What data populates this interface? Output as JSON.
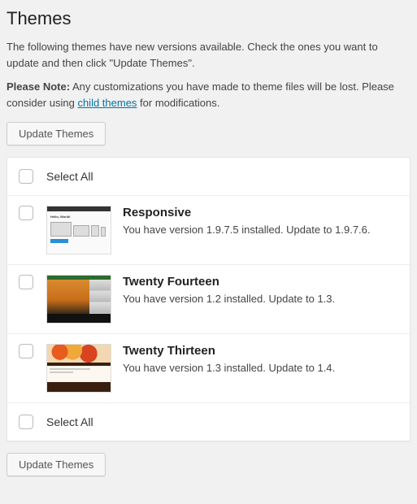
{
  "heading": "Themes",
  "intro": "The following themes have new versions available. Check the ones you want to update and then click \"Update Themes\".",
  "note_label": "Please Note:",
  "note_before": " Any customizations you have made to theme files will be lost. Please consider using ",
  "note_link": "child themes",
  "note_after": " for modifications.",
  "update_button": "Update Themes",
  "select_all": "Select All",
  "themes": [
    {
      "name": "Responsive",
      "desc": "You have version 1.9.7.5 installed. Update to 1.9.7.6.",
      "thumb": "responsive"
    },
    {
      "name": "Twenty Fourteen",
      "desc": "You have version 1.2 installed. Update to 1.3.",
      "thumb": "2014"
    },
    {
      "name": "Twenty Thirteen",
      "desc": "You have version 1.3 installed. Update to 1.4.",
      "thumb": "2013"
    }
  ]
}
